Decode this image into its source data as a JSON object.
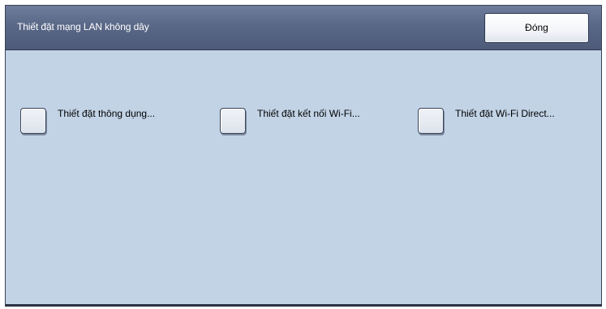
{
  "dialog": {
    "title": "Thiết đặt mạng LAN không dây",
    "close_label": "Đóng"
  },
  "options": [
    {
      "label": "Thiết đặt thông dụng..."
    },
    {
      "label": "Thiết đặt kết nối Wi-Fi..."
    },
    {
      "label": "Thiết đặt Wi-Fi Direct..."
    }
  ]
}
